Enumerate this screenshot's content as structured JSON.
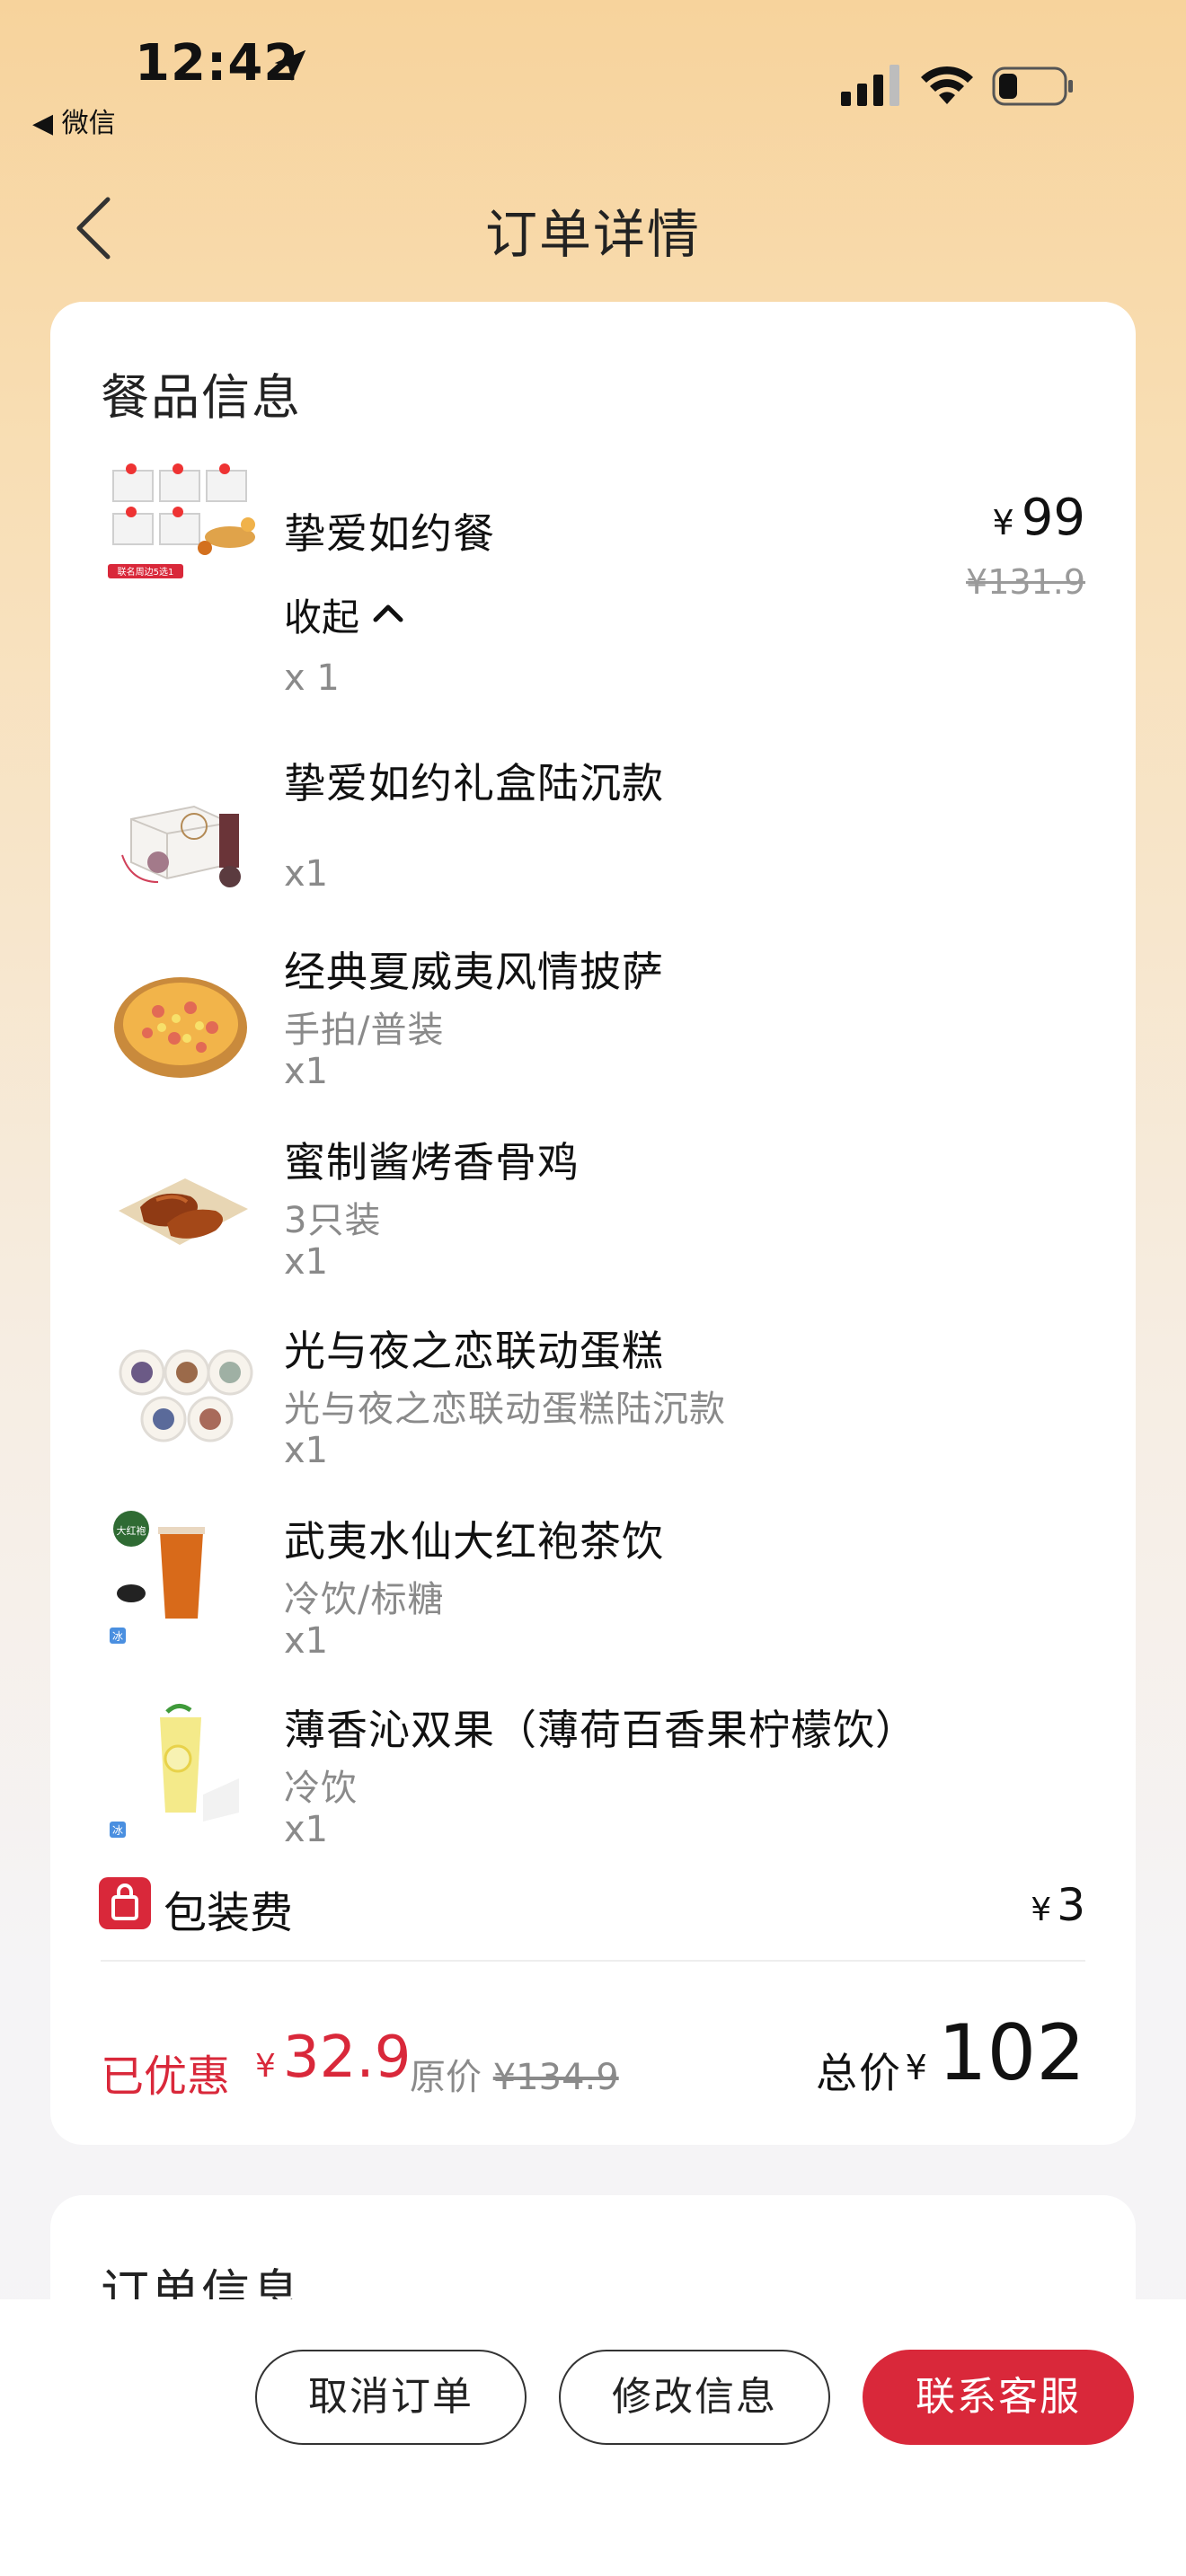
{
  "status_bar": {
    "time": "12:42",
    "back_app": "◀ 微信"
  },
  "nav": {
    "title": "订单详情"
  },
  "meal_section": {
    "title": "餐品信息",
    "combo": {
      "name": "挚爱如约餐",
      "collapse_label": "收起",
      "qty": "x 1",
      "price_symbol": "¥",
      "price": "99",
      "original_price": "¥131.9",
      "image_badge": "联名周边5选1"
    },
    "items": [
      {
        "name": "挚爱如约礼盒陆沉款",
        "spec": "",
        "qty": "x1"
      },
      {
        "name": "经典夏威夷风情披萨",
        "spec": "手拍/普装",
        "qty": "x1"
      },
      {
        "name": "蜜制酱烤香骨鸡",
        "spec": "3只装",
        "qty": "x1"
      },
      {
        "name": "光与夜之恋联动蛋糕",
        "spec": "光与夜之恋联动蛋糕陆沉款",
        "qty": "x1"
      },
      {
        "name": "武夷水仙大红袍茶饮",
        "spec": "冷饮/标糖",
        "qty": "x1"
      },
      {
        "name": "薄香沁双果（薄荷百香果柠檬饮）",
        "spec": "冷饮",
        "qty": "x1"
      }
    ],
    "tea_badge": "大红袍",
    "ice_badge": "冰",
    "packaging": {
      "label": "包装费",
      "price_symbol": "¥",
      "price": "3"
    },
    "summary": {
      "discount_label": "已优惠",
      "discount_symbol": "¥",
      "discount": "32.9",
      "orig_label": "原价",
      "orig_total": "¥134.9",
      "total_label": "总价",
      "total_symbol": "¥",
      "total": "102"
    }
  },
  "order_section": {
    "title": "订单信息"
  },
  "actions": {
    "cancel": "取消订单",
    "modify": "修改信息",
    "contact": "联系客服"
  },
  "colors": {
    "accent": "#d9283a",
    "header_bg": "#f7d39c"
  }
}
